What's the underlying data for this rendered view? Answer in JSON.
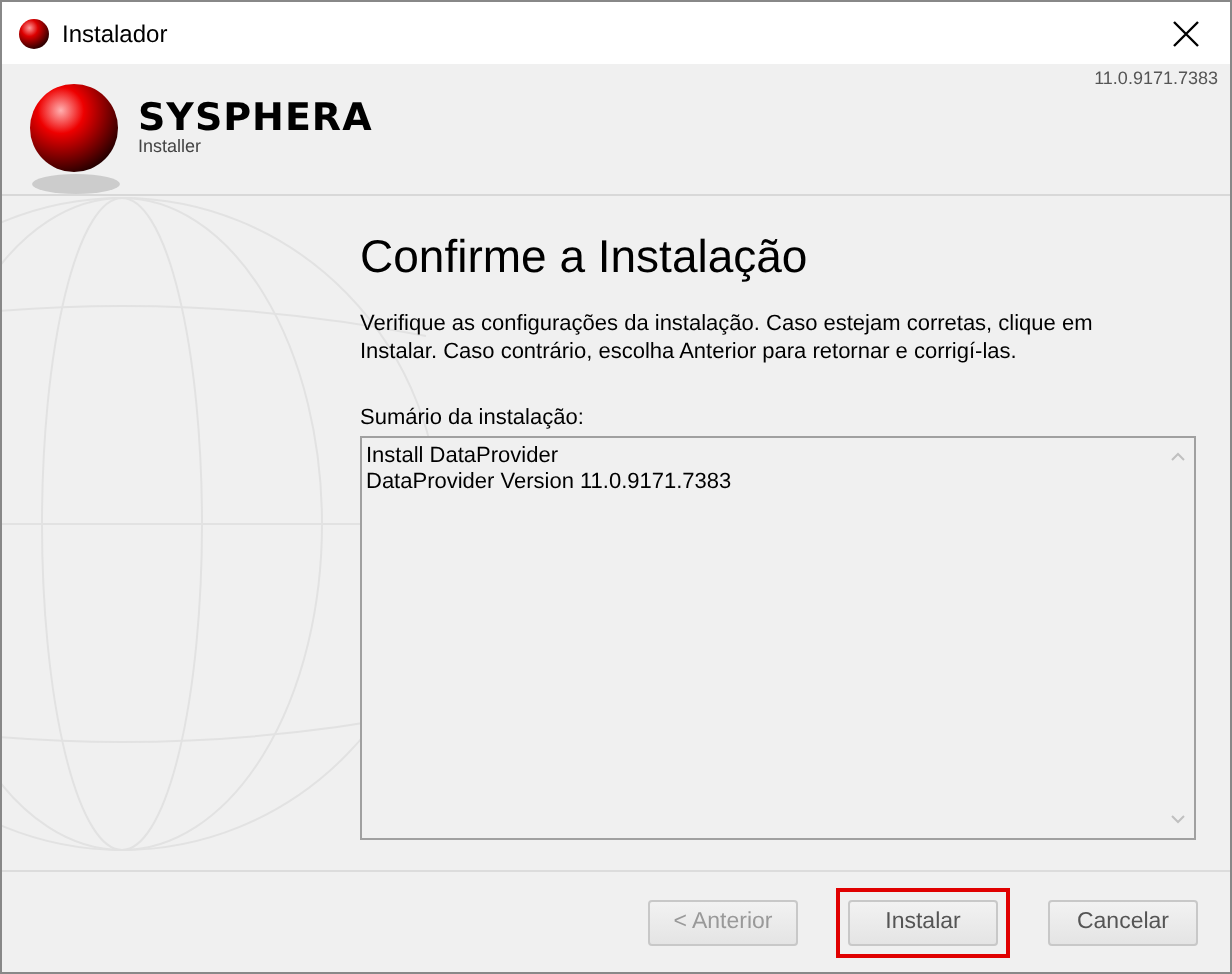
{
  "window": {
    "title": "Instalador"
  },
  "header": {
    "brand": "SYSPHERA",
    "subtitle": "Installer",
    "version": "11.0.9171.7383"
  },
  "page": {
    "heading": "Confirme a Instalação",
    "description": "Verifique as configurações da instalação. Caso estejam corretas, clique em Instalar. Caso contrário, escolha Anterior para retornar e corrigí-las.",
    "summary_label": "Sumário da instalação:",
    "summary_lines": [
      "Install DataProvider",
      "DataProvider Version 11.0.9171.7383"
    ]
  },
  "buttons": [
    {
      "label": "< Anterior",
      "disabled": true,
      "highlighted": false
    },
    {
      "label": "Instalar",
      "disabled": false,
      "highlighted": true
    },
    {
      "label": "Cancelar",
      "disabled": false,
      "highlighted": false
    }
  ]
}
